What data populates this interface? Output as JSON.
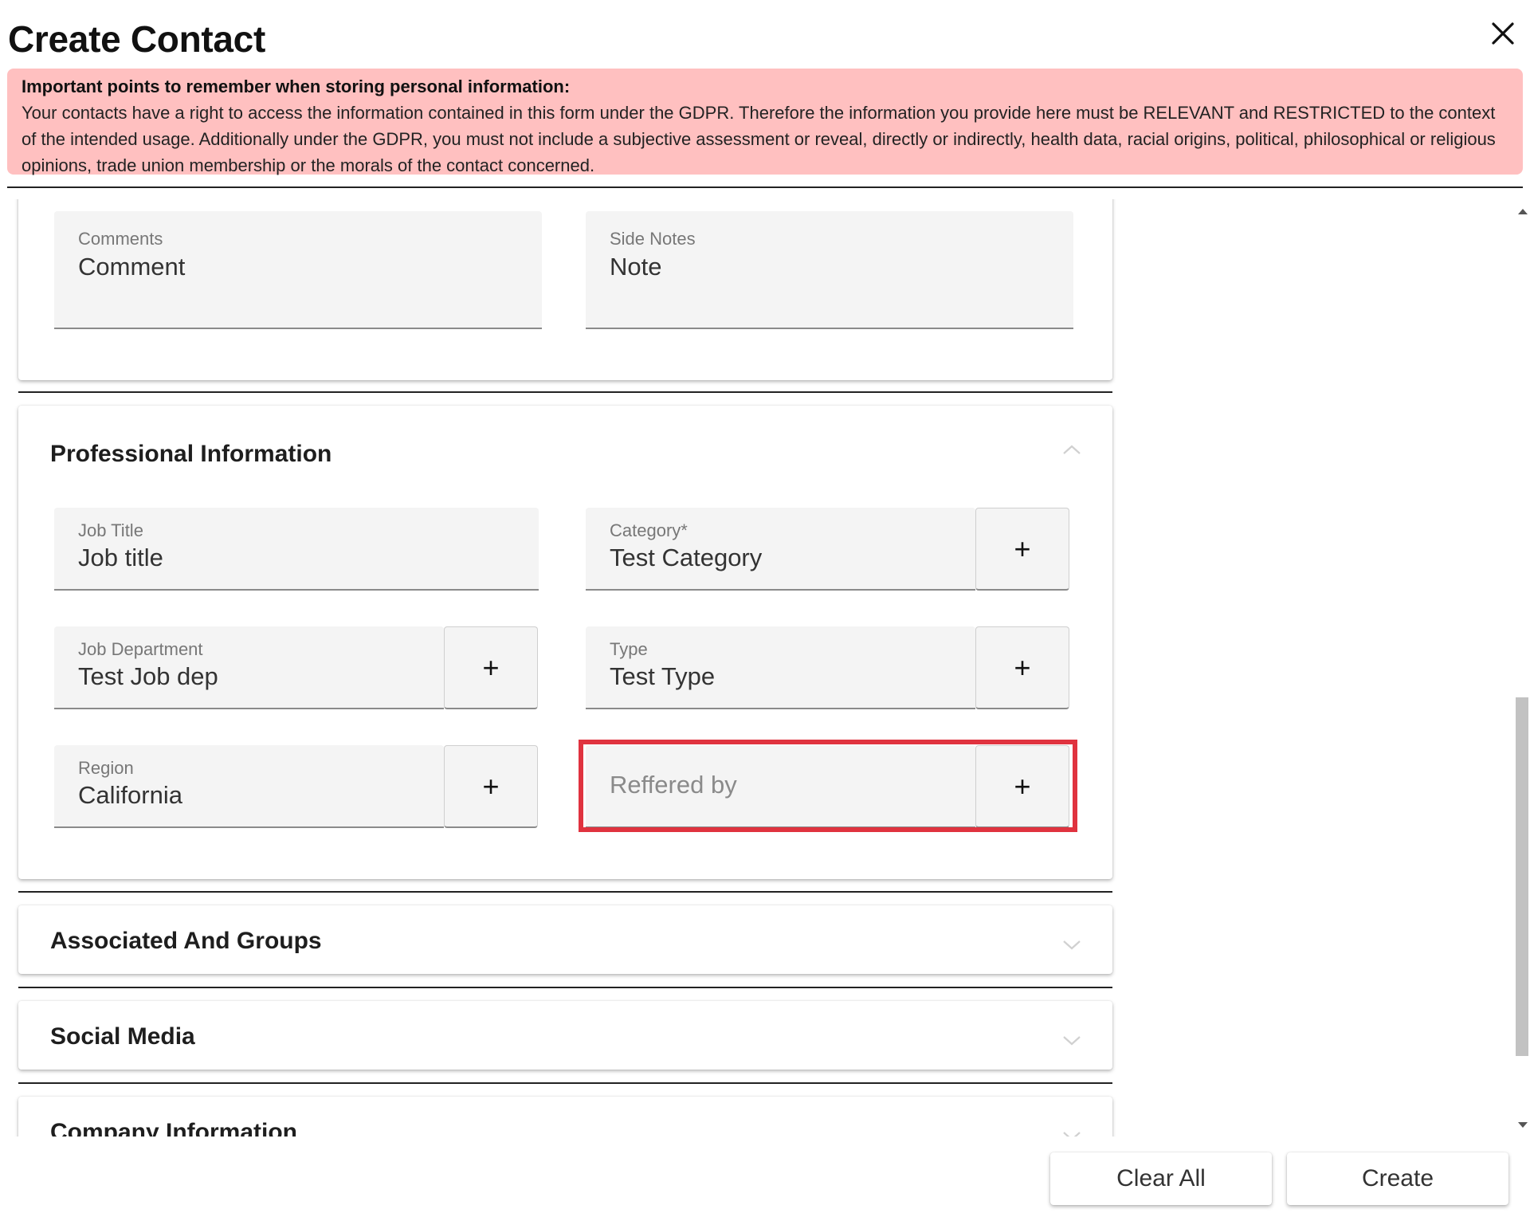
{
  "dialog": {
    "title": "Create Contact"
  },
  "gdpr": {
    "heading": "Important points to remember when storing personal information:",
    "line1": "Your contacts have a right to access the information contained in this form under the GDPR. Therefore the information you provide here must be RELEVANT and RESTRICTED to the context",
    "line2": "of the intended usage. Additionally under the GDPR, you must not include a subjective assessment or reveal, directly or indirectly, health data, racial origins, political, philosophical or religious",
    "line3": "opinions, trade union membership or the morals of the contact concerned."
  },
  "notes": {
    "comments": {
      "label": "Comments",
      "value": "Comment"
    },
    "side_notes": {
      "label": "Side Notes",
      "value": "Note"
    }
  },
  "professional": {
    "title": "Professional Information",
    "job_title": {
      "label": "Job Title",
      "value": "Job title"
    },
    "category": {
      "label": "Category*",
      "value": "Test Category"
    },
    "job_department": {
      "label": "Job Department",
      "value": "Test Job dep"
    },
    "type": {
      "label": "Type",
      "value": "Test Type"
    },
    "region": {
      "label": "Region",
      "value": "California"
    },
    "referred_by": {
      "placeholder": "Reffered by"
    },
    "add_symbol": "+"
  },
  "sections": {
    "associated": "Associated And Groups",
    "social": "Social Media",
    "company": "Company Information"
  },
  "footer": {
    "clear_label": "Clear All",
    "create_label": "Create"
  },
  "colors": {
    "banner_bg": "#ffc0c0",
    "highlight": "#e0333f",
    "field_bg": "#f4f4f4"
  },
  "icons": {
    "close": "close-icon",
    "expanded": "chevron-up-icon",
    "collapsed": "chevron-down-icon"
  }
}
